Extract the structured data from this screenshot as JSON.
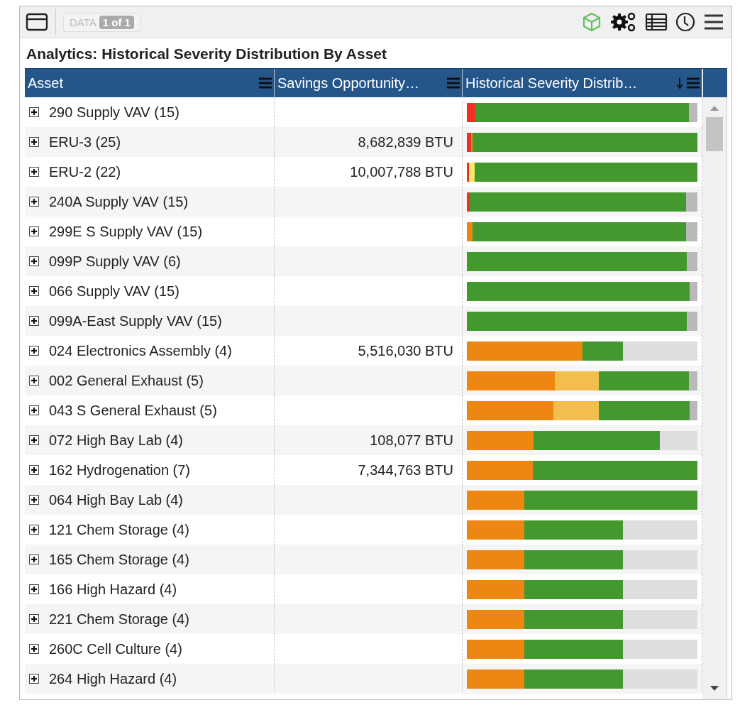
{
  "toolbar": {
    "data_label": "DATA",
    "page_badge": "1 of 1"
  },
  "title": "Analytics: Historical Severity Distribution By Asset",
  "table": {
    "columns": [
      "Asset",
      "Savings Opportunity…",
      "Historical Severity Distrib…"
    ],
    "rows": [
      {
        "asset": "290 Supply VAV (15)",
        "savings": "",
        "segments": [
          {
            "color": "#ee3124"
          },
          {
            "color": "#43992e"
          },
          {
            "color": "#b9b9b9"
          }
        ]
      },
      {
        "asset": "ERU-3 (25)",
        "savings": "8,682,839 BTU",
        "segments": [
          {
            "color": "#ee3124"
          },
          {
            "color": "#ee8711"
          },
          {
            "color": "#43992e"
          }
        ]
      },
      {
        "asset": "ERU-2 (22)",
        "savings": "10,007,788 BTU",
        "segments": [
          {
            "color": "#ee3124"
          },
          {
            "color": "#f9e96b"
          },
          {
            "color": "#43992e"
          }
        ]
      },
      {
        "asset": "240A Supply VAV (15)",
        "savings": "",
        "segments": [
          {
            "color": "#ee3124"
          },
          {
            "color": "#43992e"
          },
          {
            "color": "#b9b9b9"
          }
        ]
      },
      {
        "asset": "299E S Supply VAV (15)",
        "savings": "",
        "segments": [
          {
            "color": "#ee8711"
          },
          {
            "color": "#43992e"
          },
          {
            "color": "#b9b9b9"
          }
        ]
      },
      {
        "asset": "099P Supply VAV (6)",
        "savings": "",
        "segments": [
          {
            "color": "#43992e"
          },
          {
            "color": "#b9b9b9"
          }
        ]
      },
      {
        "asset": "066 Supply VAV (15)",
        "savings": "",
        "segments": [
          {
            "color": "#43992e"
          },
          {
            "color": "#b9b9b9"
          }
        ]
      },
      {
        "asset": "099A-East Supply VAV (15)",
        "savings": "",
        "segments": [
          {
            "color": "#43992e"
          },
          {
            "color": "#b9b9b9"
          }
        ]
      },
      {
        "asset": "024 Electronics Assembly (4)",
        "savings": "5,516,030 BTU",
        "segments": [
          {
            "color": "#ee8711"
          },
          {
            "color": "#43992e"
          }
        ]
      },
      {
        "asset": "002 General Exhaust (5)",
        "savings": "",
        "segments": [
          {
            "color": "#ee8711"
          },
          {
            "color": "#f2bf4f"
          },
          {
            "color": "#43992e"
          },
          {
            "color": "#b9b9b9"
          }
        ]
      },
      {
        "asset": "043 S General Exhaust (5)",
        "savings": "",
        "segments": [
          {
            "color": "#ee8711"
          },
          {
            "color": "#f2bf4f"
          },
          {
            "color": "#43992e"
          },
          {
            "color": "#b9b9b9"
          }
        ]
      },
      {
        "asset": "072 High Bay Lab (4)",
        "savings": "108,077 BTU",
        "segments": [
          {
            "color": "#ee8711"
          },
          {
            "color": "#43992e"
          }
        ]
      },
      {
        "asset": "162 Hydrogenation (7)",
        "savings": "7,344,763 BTU",
        "segments": [
          {
            "color": "#ee8711"
          },
          {
            "color": "#43992e"
          }
        ]
      },
      {
        "asset": "064 High Bay Lab (4)",
        "savings": "",
        "segments": [
          {
            "color": "#ee8711"
          },
          {
            "color": "#43992e"
          }
        ]
      },
      {
        "asset": "121 Chem Storage (4)",
        "savings": "",
        "segments": [
          {
            "color": "#ee8711"
          },
          {
            "color": "#43992e"
          }
        ]
      },
      {
        "asset": "165 Chem Storage (4)",
        "savings": "",
        "segments": [
          {
            "color": "#ee8711"
          },
          {
            "color": "#43992e"
          }
        ]
      },
      {
        "asset": "166 High Hazard (4)",
        "savings": "",
        "segments": [
          {
            "color": "#ee8711"
          },
          {
            "color": "#43992e"
          }
        ]
      },
      {
        "asset": "221 Chem Storage (4)",
        "savings": "",
        "segments": [
          {
            "color": "#ee8711"
          },
          {
            "color": "#43992e"
          }
        ]
      },
      {
        "asset": "260C Cell Culture (4)",
        "savings": "",
        "segments": [
          {
            "color": "#ee8711"
          },
          {
            "color": "#43992e"
          }
        ]
      },
      {
        "asset": "264 High Hazard (4)",
        "savings": "",
        "segments": [
          {
            "color": "#ee8711"
          },
          {
            "color": "#43992e"
          }
        ]
      }
    ]
  }
}
